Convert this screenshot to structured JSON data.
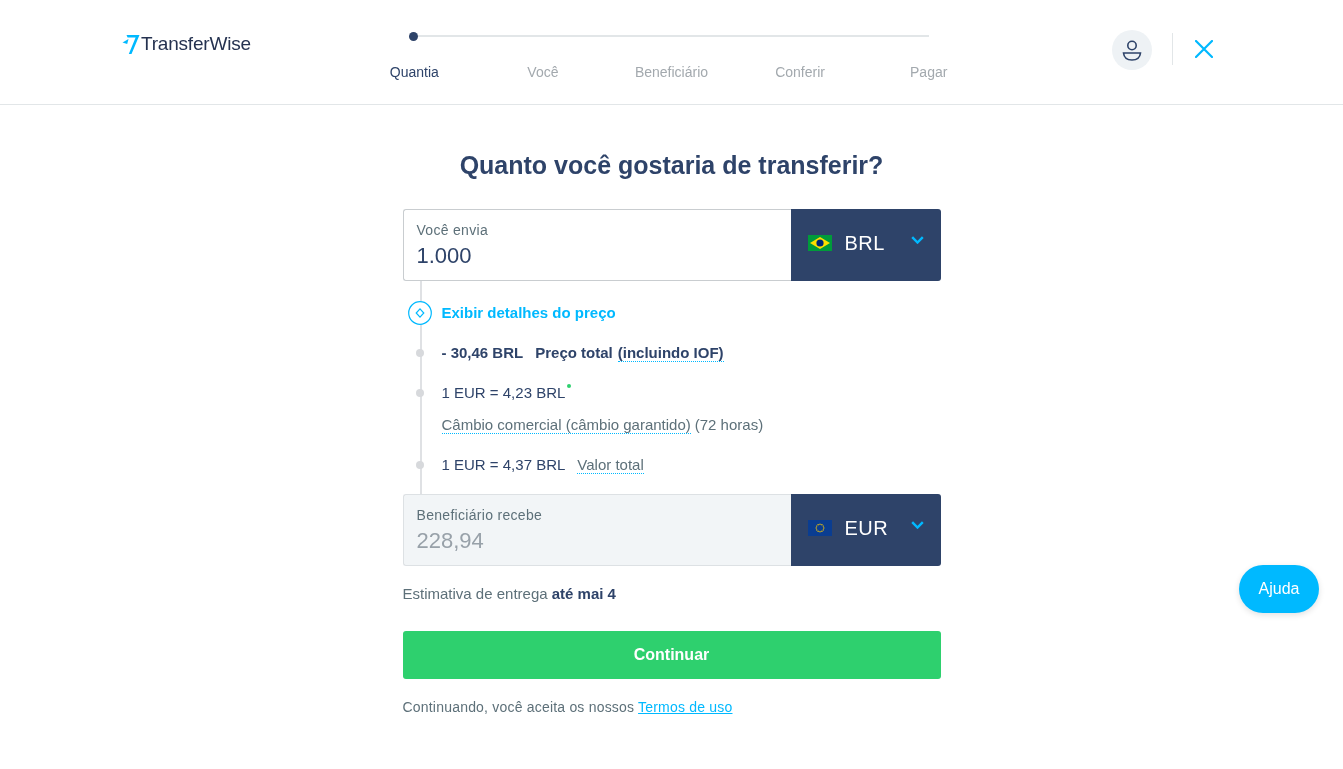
{
  "header": {
    "logo": "TransferWise",
    "steps": [
      {
        "label": "Quantia",
        "selected": true
      },
      {
        "label": "Você",
        "selected": false
      },
      {
        "label": "Beneficiário",
        "selected": false
      },
      {
        "label": "Conferir",
        "selected": false
      },
      {
        "label": "Pagar",
        "selected": false
      }
    ]
  },
  "title": "Quanto você gostaria de transferir?",
  "send": {
    "label": "Você envia",
    "value": "1.000",
    "currency": "BRL",
    "disabled": false
  },
  "breakdown": [
    {
      "kind": "toggle",
      "label": "Exibir detalhes do preço"
    },
    {
      "kind": "fee",
      "amount": "- 30,46 BRL",
      "label": "Preço total",
      "hint": "(incluindo IOF)"
    },
    {
      "kind": "rate",
      "rate": "1 EUR = 4,23 BRL",
      "rate_type": "Câmbio comercial (câmbio garantido)",
      "note": "(72 horas)"
    },
    {
      "kind": "total",
      "rate": "1 EUR = 4,37 BRL",
      "hint": "Valor total"
    }
  ],
  "receive": {
    "label": "Beneficiário recebe",
    "value": "228,94",
    "currency": "EUR",
    "disabled": true
  },
  "delivery": "Estimativa de entrega **até mai 4**",
  "continue_button": "Continuar",
  "terms": {
    "text": "Continuando, você aceita os nossos",
    "link": "Termos de uso"
  },
  "help_button": "Ajuda"
}
